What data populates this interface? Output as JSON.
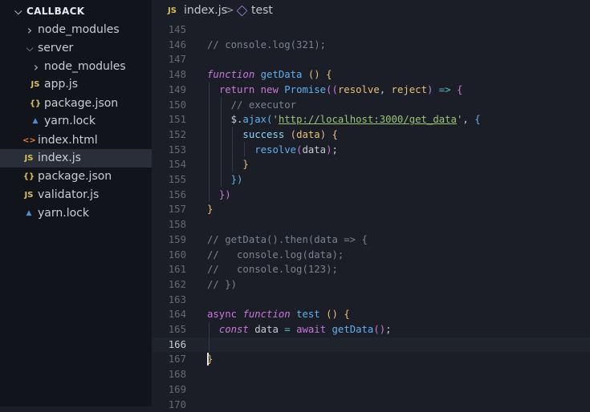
{
  "sidebar": {
    "header": "CALLBACK",
    "items": [
      {
        "label": "node_modules",
        "type": "folder",
        "state": "collapsed",
        "depth": 1
      },
      {
        "label": "server",
        "type": "folder",
        "state": "expanded",
        "depth": 1
      },
      {
        "label": "node_modules",
        "type": "folder",
        "state": "collapsed",
        "depth": 2
      },
      {
        "label": "app.js",
        "type": "js",
        "depth": 2
      },
      {
        "label": "package.json",
        "type": "json",
        "depth": 2
      },
      {
        "label": "yarn.lock",
        "type": "yarn",
        "depth": 2
      },
      {
        "label": "index.html",
        "type": "html",
        "depth": 1
      },
      {
        "label": "index.js",
        "type": "js",
        "depth": 1,
        "active": true
      },
      {
        "label": "package.json",
        "type": "json",
        "depth": 1
      },
      {
        "label": "validator.js",
        "type": "js",
        "depth": 1
      },
      {
        "label": "yarn.lock",
        "type": "yarn",
        "depth": 1
      }
    ],
    "icons": {
      "js": "JS",
      "json": "{}",
      "html": "<>",
      "yarn": "yarn-icon"
    }
  },
  "breadcrumb": {
    "file_icon": "JS",
    "file": "index.js",
    "separator": ">",
    "symbol_icon": "cube-icon",
    "symbol": "test"
  },
  "editor": {
    "current_line": 166,
    "lines": [
      {
        "n": "145",
        "tokens": []
      },
      {
        "n": "146",
        "tokens": [
          [
            "cm",
            "// console.log(321);"
          ]
        ]
      },
      {
        "n": "147",
        "tokens": []
      },
      {
        "n": "148",
        "tokens": [
          [
            "kwi",
            "function"
          ],
          [
            "pl",
            " "
          ],
          [
            "fn",
            "getData"
          ],
          [
            "pl",
            " "
          ],
          [
            "b1",
            "()"
          ],
          [
            "pl",
            " "
          ],
          [
            "b1",
            "{"
          ]
        ]
      },
      {
        "n": "149",
        "tokens": [
          [
            "pl",
            "  "
          ],
          [
            "kw",
            "return"
          ],
          [
            "pl",
            " "
          ],
          [
            "kw",
            "new"
          ],
          [
            "pl",
            " "
          ],
          [
            "cls",
            "Promise"
          ],
          [
            "b2",
            "(("
          ],
          [
            "par",
            "resolve"
          ],
          [
            "pl",
            ", "
          ],
          [
            "par",
            "reject"
          ],
          [
            "b2",
            ")"
          ],
          [
            "pl",
            " "
          ],
          [
            "op",
            "=>"
          ],
          [
            "pl",
            " "
          ],
          [
            "b2",
            "{"
          ]
        ]
      },
      {
        "n": "150",
        "tokens": [
          [
            "pl",
            "    "
          ],
          [
            "cm",
            "// executor"
          ]
        ]
      },
      {
        "n": "151",
        "tokens": [
          [
            "pl",
            "    $."
          ],
          [
            "fn",
            "ajax"
          ],
          [
            "b3",
            "("
          ],
          [
            "sq",
            "'"
          ],
          [
            "str",
            "http://localhost:3000/get_data"
          ],
          [
            "sq",
            "'"
          ],
          [
            "pl",
            ", "
          ],
          [
            "b3",
            "{"
          ]
        ]
      },
      {
        "n": "152",
        "tokens": [
          [
            "pl",
            "      "
          ],
          [
            "fnb",
            "success"
          ],
          [
            "pl",
            " "
          ],
          [
            "b1",
            "("
          ],
          [
            "par",
            "data"
          ],
          [
            "b1",
            ")"
          ],
          [
            "pl",
            " "
          ],
          [
            "b1",
            "{"
          ]
        ]
      },
      {
        "n": "153",
        "tokens": [
          [
            "pl",
            "        "
          ],
          [
            "fn",
            "resolve"
          ],
          [
            "b2",
            "("
          ],
          [
            "pl",
            "data"
          ],
          [
            "b2",
            ")"
          ],
          [
            "pl",
            ";"
          ]
        ]
      },
      {
        "n": "154",
        "tokens": [
          [
            "pl",
            "      "
          ],
          [
            "b1",
            "}"
          ]
        ]
      },
      {
        "n": "155",
        "tokens": [
          [
            "pl",
            "    "
          ],
          [
            "b3",
            "})"
          ]
        ]
      },
      {
        "n": "156",
        "tokens": [
          [
            "pl",
            "  "
          ],
          [
            "b2",
            "})"
          ]
        ]
      },
      {
        "n": "157",
        "tokens": [
          [
            "b1",
            "}"
          ]
        ]
      },
      {
        "n": "158",
        "tokens": []
      },
      {
        "n": "159",
        "tokens": [
          [
            "cm",
            "// getData().then(data => {"
          ]
        ]
      },
      {
        "n": "160",
        "tokens": [
          [
            "cm",
            "//   console.log(data);"
          ]
        ]
      },
      {
        "n": "161",
        "tokens": [
          [
            "cm",
            "//   console.log(123);"
          ]
        ]
      },
      {
        "n": "162",
        "tokens": [
          [
            "cm",
            "// })"
          ]
        ]
      },
      {
        "n": "163",
        "tokens": []
      },
      {
        "n": "164",
        "tokens": [
          [
            "kw",
            "async"
          ],
          [
            "pl",
            " "
          ],
          [
            "kwi",
            "function"
          ],
          [
            "pl",
            " "
          ],
          [
            "fn",
            "test"
          ],
          [
            "pl",
            " "
          ],
          [
            "b1",
            "()"
          ],
          [
            "pl",
            " "
          ],
          [
            "b1",
            "{"
          ]
        ]
      },
      {
        "n": "165",
        "tokens": [
          [
            "pl",
            "  "
          ],
          [
            "kwi",
            "const"
          ],
          [
            "pl",
            " data "
          ],
          [
            "op",
            "="
          ],
          [
            "pl",
            " "
          ],
          [
            "kw",
            "await"
          ],
          [
            "pl",
            " "
          ],
          [
            "fn",
            "getData"
          ],
          [
            "b2",
            "()"
          ],
          [
            "pl",
            ";"
          ]
        ]
      },
      {
        "n": "166",
        "tokens": []
      },
      {
        "n": "167",
        "tokens": [
          [
            "b1",
            "}"
          ]
        ]
      },
      {
        "n": "168",
        "tokens": []
      },
      {
        "n": "169",
        "tokens": []
      },
      {
        "n": "170",
        "tokens": []
      }
    ]
  }
}
